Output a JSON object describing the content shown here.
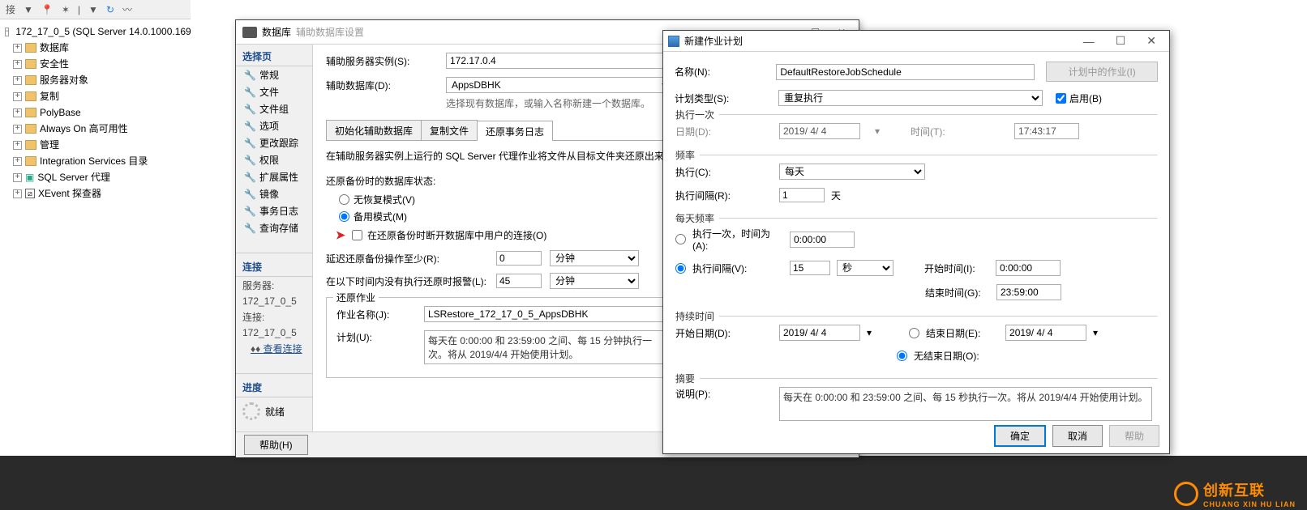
{
  "toolbar": {
    "t1": "接",
    "t7": "▼"
  },
  "tree": {
    "server": "172_17_0_5 (SQL Server 14.0.1000.169",
    "items": [
      "数据库",
      "安全性",
      "服务器对象",
      "复制",
      "PolyBase",
      "Always On 高可用性",
      "管理",
      "Integration Services 目录",
      "SQL Server 代理",
      "XEvent 探查器"
    ]
  },
  "dlg1": {
    "title_cat": "数据库",
    "title": "辅助数据库设置",
    "side_header": "选择页",
    "side_opts": [
      "常规",
      "文件",
      "文件组",
      "选项",
      "更改跟踪",
      "权限",
      "扩展属性",
      "镜像",
      "事务日志",
      "查询存储"
    ],
    "side_conn": "连接",
    "side_srv_lbl": "服务器:",
    "side_srv_val": "172_17_0_5",
    "side_conn_lbl": "连接:",
    "side_conn_val": "172_17_0_5",
    "side_viewconn": "查看连接",
    "side_prog": "进度",
    "side_ready": "就绪",
    "help_btn": "帮助(H)",
    "f_instance": "辅助服务器实例(S):",
    "f_instance_val": "172.17.0.4",
    "f_db": "辅助数据库(D):",
    "f_db_val": "AppsDBHK",
    "f_db_hint": "选择现有数据库，或输入名称新建一个数据库。",
    "tabs": [
      "初始化辅助数据库",
      "复制文件",
      "还原事务日志"
    ],
    "info": "在辅助服务器实例上运行的 SQL Server 代理作业将文件从目标文件夹还原出来。",
    "grp_state": "还原备份时的数据库状态:",
    "r_norec": "无恢复模式(V)",
    "r_standby": "备用模式(M)",
    "chk_disconnect": "在还原备份时断开数据库中用户的连接(O)",
    "f_delay": "延迟还原备份操作至少(R):",
    "f_delay_v": "0",
    "f_delay_u": "分钟",
    "f_alert": "在以下时间内没有执行还原时报警(L):",
    "f_alert_v": "45",
    "f_alert_u": "分钟",
    "grp_restore": "还原作业",
    "f_jobname": "作业名称(J):",
    "f_jobname_v": "LSRestore_172_17_0_5_AppsDBHK",
    "f_sched": "计划(U):",
    "f_sched_v": "每天在 0:00:00 和 23:59:00 之间、每 15 分钟执行一次。将从 2019/4/4 开始使用计划。"
  },
  "dlg2": {
    "title": "新建作业计划",
    "f_name": "名称(N):",
    "f_name_v": "DefaultRestoreJobSchedule",
    "btn_jobs": "计划中的作业(I)",
    "f_type": "计划类型(S):",
    "f_type_v": "重复执行",
    "chk_enabled": "启用(B)",
    "grp_once": "执行一次",
    "f_date": "日期(D):",
    "f_date_v": "2019/ 4/ 4",
    "f_time": "时间(T):",
    "f_time_v": "17:43:17",
    "grp_freq": "频率",
    "f_exec": "执行(C):",
    "f_exec_v": "每天",
    "f_interval": "执行间隔(R):",
    "f_interval_v": "1",
    "f_interval_u": "天",
    "grp_daily": "每天频率",
    "r_once": "执行一次，时间为(A):",
    "r_once_v": "0:00:00",
    "r_every": "执行间隔(V):",
    "r_every_v": "15",
    "r_every_u": "秒",
    "f_start": "开始时间(I):",
    "f_start_v": "0:00:00",
    "f_end": "结束时间(G):",
    "f_end_v": "23:59:00",
    "grp_dur": "持续时间",
    "f_startd": "开始日期(D):",
    "f_startd_v": "2019/ 4/ 4",
    "r_endd": "结束日期(E):",
    "r_endd_v": "2019/ 4/ 4",
    "r_noend": "无结束日期(O):",
    "grp_sum": "摘要",
    "f_desc": "说明(P):",
    "f_desc_v": "每天在 0:00:00 和 23:59:00 之间、每 15 秒执行一次。将从 2019/4/4 开始使用计划。",
    "btn_ok": "确定",
    "btn_cancel": "取消",
    "btn_help": "帮助"
  },
  "brand_cn": "创新互联",
  "brand_en": "CHUANG XIN HU LIAN"
}
